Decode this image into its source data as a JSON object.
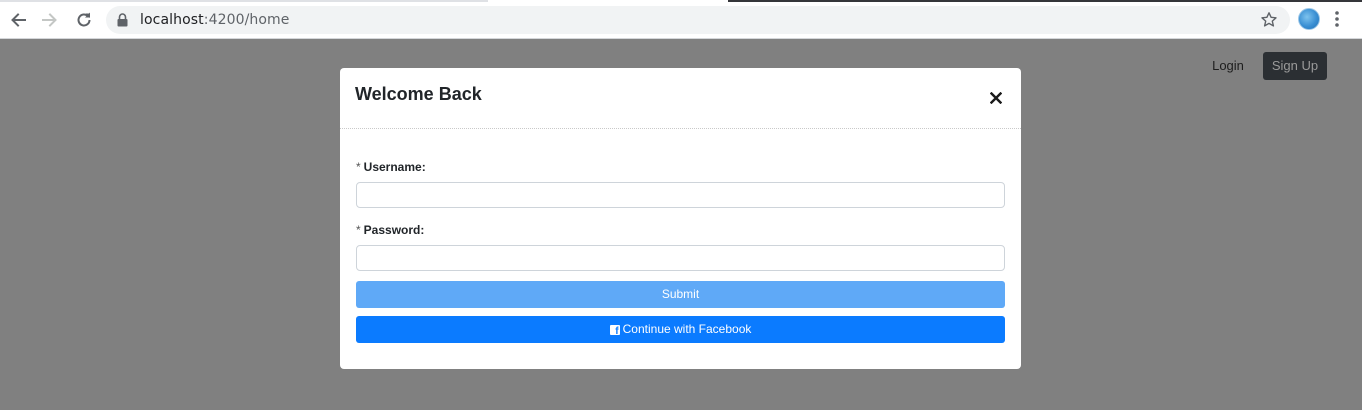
{
  "browser": {
    "url_domain": "localhost",
    "url_path": ":4200/home"
  },
  "nav": {
    "login_label": "Login",
    "signup_label": "Sign Up"
  },
  "modal": {
    "title": "Welcome Back",
    "close_label": "×",
    "username_required": "*",
    "username_label": "Username:",
    "username_value": "",
    "password_required": "*",
    "password_label": "Password:",
    "password_value": "",
    "submit_label": "Submit",
    "facebook_label": "Continue with Facebook",
    "facebook_icon": "f"
  },
  "colors": {
    "overlay": "#808080",
    "submit_button": "#5fa9f7",
    "facebook_button": "#0b7bff",
    "signup_button": "#2b2f33"
  }
}
